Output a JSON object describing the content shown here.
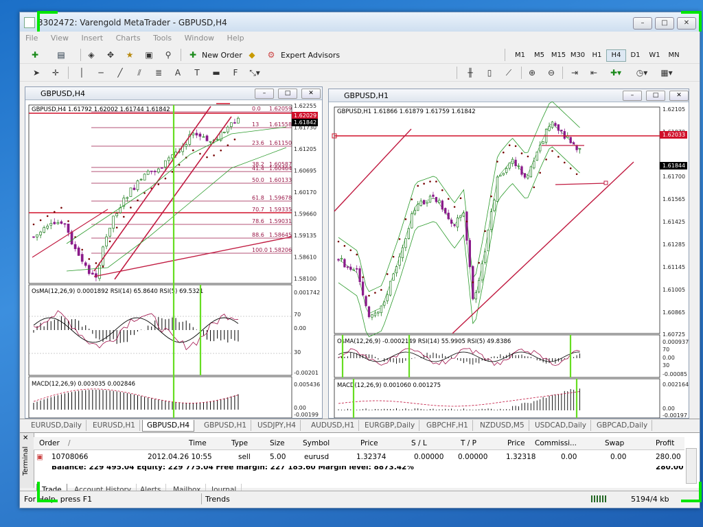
{
  "window": {
    "title": "3302472: Varengold MetaTrader - GBPUSD,H4",
    "buttons": [
      "–",
      "□",
      "✕"
    ]
  },
  "menu": [
    "File",
    "View",
    "Insert",
    "Charts",
    "Tools",
    "Window",
    "Help"
  ],
  "toolbar": {
    "new_order": "New Order",
    "expert_advisors": "Expert Advisors",
    "timeframes": [
      "M1",
      "M5",
      "M15",
      "M30",
      "H1",
      "H4",
      "D1",
      "W1",
      "MN"
    ],
    "active_timeframe": "H4",
    "text_tool": "A"
  },
  "chart_left": {
    "title": "GBPUSD,H4",
    "header": "GBPUSD,H4  1.61792 1.62002 1.61744 1.61842",
    "price_axis": [
      "1.62255",
      "1.61730",
      "1.61205",
      "1.60695",
      "1.60170",
      "1.59660",
      "1.59135",
      "1.58610",
      "1.58100"
    ],
    "bid_label": "1.62029",
    "ask_label": "1.61842",
    "fib": [
      {
        "level": "0.0",
        "price": "1.62059"
      },
      {
        "level": "13",
        "price": "1.61558"
      },
      {
        "level": "23.6",
        "price": "1.61150"
      },
      {
        "level": "38.2",
        "price": "1.60587"
      },
      {
        "level": "41.4",
        "price": "1.60464"
      },
      {
        "level": "50.0",
        "price": "1.60133"
      },
      {
        "level": "61.8",
        "price": "1.59678"
      },
      {
        "level": "70.7",
        "price": "1.59335"
      },
      {
        "level": "78.6",
        "price": "1.59031"
      },
      {
        "level": "88.6",
        "price": "1.58645"
      },
      {
        "level": "100.0",
        "price": "1.58206"
      }
    ],
    "osma_header": "OsMA(12,26,9) 0.0001892  RSI(14) 65.8640  RSI(5) 69.5321",
    "osma_axis": [
      "0.001742",
      "70",
      "0.00",
      "30",
      "-0.00201"
    ],
    "macd_header": "MACD(12,26,9) 0.003035 0.002846",
    "macd_axis": [
      "0.005436",
      "0.00",
      "-0.00199"
    ]
  },
  "chart_right": {
    "title": "GBPUSD,H1",
    "header": "GBPUSD,H1  1.61866 1.61879 1.61759 1.61842",
    "price_axis": [
      "1.62105",
      "1.61970",
      "1.61700",
      "1.61565",
      "1.61425",
      "1.61285",
      "1.61145",
      "1.61005",
      "1.60865",
      "1.60725"
    ],
    "bid_label": "1.62033",
    "ask_label": "1.61844",
    "osma_header": "OsMA(12,26,9) -0.0002149  RSI(14) 55.9905  RSI(5) 49.8386",
    "osma_axis": [
      "0.000937",
      "70",
      "0.00",
      "30",
      "-0.00085"
    ],
    "macd_header": "MACD(12,26,9) 0.001060 0.001275",
    "macd_axis": [
      "0.002164",
      "0.00",
      "-0.00197"
    ]
  },
  "chart_tabs": [
    "EURUSD,Daily",
    "EURUSD,H1",
    "GBPUSD,H4",
    "GBPUSD,H1",
    "USDJPY,H4",
    "AUDUSD,H1",
    "EURGBP,Daily",
    "GBPCHF,H1",
    "NZDUSD,M5",
    "USDCAD,Daily",
    "GBPCAD,Daily"
  ],
  "active_chart_tab": "GBPUSD,H4",
  "terminal": {
    "side_label": "Terminal",
    "columns": [
      "Order",
      "/",
      "Time",
      "Type",
      "Size",
      "Symbol",
      "Price",
      "S / L",
      "T / P",
      "Price",
      "Commissi...",
      "Swap",
      "Profit"
    ],
    "row": {
      "order": "10708066",
      "time": "2012.04.26 10:55",
      "type": "sell",
      "size": "5.00",
      "symbol": "eurusd",
      "price": "1.32374",
      "sl": "0.00000",
      "tp": "0.00000",
      "cur_price": "1.32318",
      "commission": "0.00",
      "swap": "0.00",
      "profit": "280.00"
    },
    "balance_partial": "Balance: 229 495.04  Equity: 229 775.04  Free margin: 227 185.60  Margin level: 8873.42%",
    "balance_profit": "280.00",
    "tabs": [
      "Trade",
      "Account History",
      "Alerts",
      "Mailbox",
      "Journal"
    ],
    "active_tab": "Trade"
  },
  "status": {
    "help": "For Help, press F1",
    "profile": "Trends",
    "traffic": "5194/4 kb"
  },
  "colors": {
    "bull": "#1a7a1a",
    "bear": "#8a1a8a",
    "fib": "#9a1848",
    "level_red": "#d0102a",
    "marker_green": "#66dd22",
    "band": "#2a9a2a"
  }
}
